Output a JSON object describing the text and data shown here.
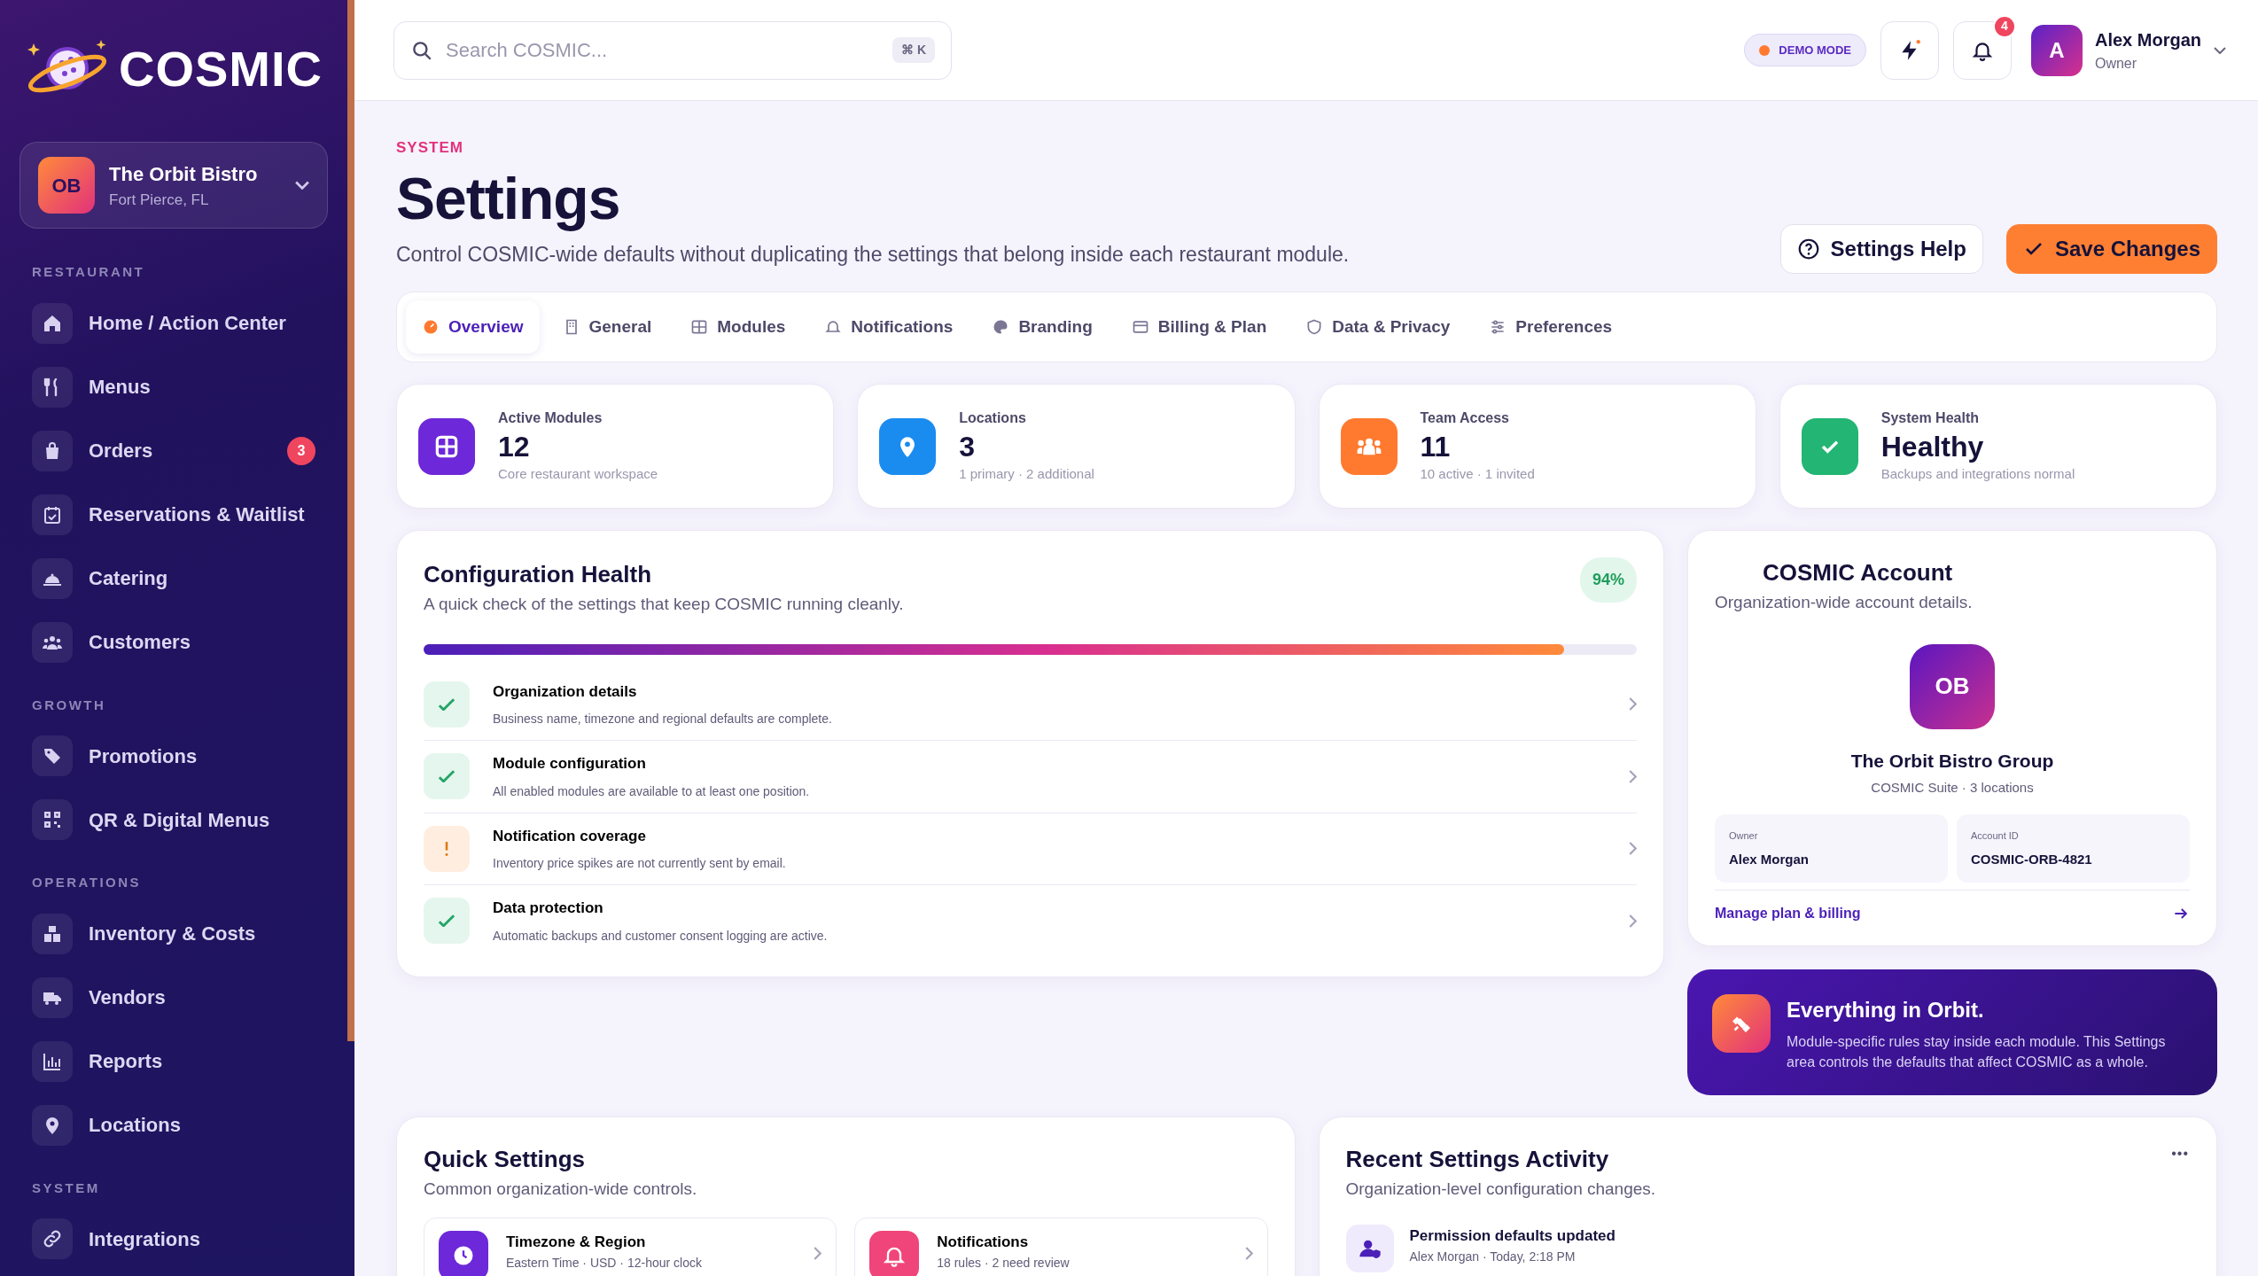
{
  "sidebar": {
    "brand": "COSMIC",
    "org": {
      "initials": "OB",
      "name": "The Orbit Bistro",
      "place": "Fort Pierce, FL"
    },
    "sections": [
      {
        "label": "RESTAURANT",
        "items": [
          {
            "label": "Home / Action Center"
          },
          {
            "label": "Menus"
          },
          {
            "label": "Orders",
            "badge": "3"
          },
          {
            "label": "Reservations & Waitlist"
          },
          {
            "label": "Catering"
          },
          {
            "label": "Customers"
          }
        ]
      },
      {
        "label": "GROWTH",
        "items": [
          {
            "label": "Promotions"
          },
          {
            "label": "QR & Digital Menus"
          }
        ]
      },
      {
        "label": "OPERATIONS",
        "items": [
          {
            "label": "Inventory & Costs"
          },
          {
            "label": "Vendors"
          },
          {
            "label": "Reports"
          },
          {
            "label": "Locations"
          }
        ]
      },
      {
        "label": "SYSTEM",
        "items": [
          {
            "label": "Integrations"
          }
        ]
      }
    ]
  },
  "topbar": {
    "search": {
      "placeholder": "Search COSMIC...",
      "shortcut": "⌘ K"
    },
    "demo": "DEMO MODE",
    "notifications": "4",
    "user": {
      "initial": "A",
      "name": "Alex Morgan",
      "role": "Owner"
    }
  },
  "header": {
    "eyebrow": "SYSTEM",
    "title": "Settings",
    "description": "Control COSMIC-wide defaults without duplicating the settings that belong inside each restaurant module.",
    "buttons": [
      {
        "label": "Settings Help",
        "kind": "secondary"
      },
      {
        "label": "Save Changes",
        "kind": "primary"
      }
    ]
  },
  "tabs": [
    {
      "label": "Overview",
      "selected": true
    },
    {
      "label": "General",
      "selected": false
    },
    {
      "label": "Modules",
      "selected": false
    },
    {
      "label": "Notifications",
      "selected": false
    },
    {
      "label": "Branding",
      "selected": false
    },
    {
      "label": "Billing & Plan",
      "selected": false
    },
    {
      "label": "Data & Privacy",
      "selected": false
    },
    {
      "label": "Preferences",
      "selected": false
    }
  ],
  "stats": [
    {
      "label": "Active Modules",
      "value": "12",
      "note": "Core restaurant workspace",
      "color": "#6d28d9"
    },
    {
      "label": "Locations",
      "value": "3",
      "note": "1 primary · 2 additional",
      "color": "#1a8cf0"
    },
    {
      "label": "Team Access",
      "value": "11",
      "note": "10 active · 1 invited",
      "color": "#ff7a2f"
    },
    {
      "label": "System Health",
      "value": "Healthy",
      "note": "Backups and integrations normal",
      "color": "#22b573"
    }
  ],
  "health": {
    "title": "Configuration Health",
    "subtitle": "A quick check of the settings that keep COSMIC running cleanly.",
    "score": "94%",
    "level": 0.94,
    "items": [
      {
        "title": "Organization details",
        "text": "Business name, timezone and regional defaults are complete.",
        "warning": false
      },
      {
        "title": "Module configuration",
        "text": "All enabled modules are available to at least one position.",
        "warning": false
      },
      {
        "title": "Notification coverage",
        "text": "Inventory price spikes are not currently sent by email.",
        "warning": true
      },
      {
        "title": "Data protection",
        "text": "Automatic backups and customer consent logging are active.",
        "warning": false
      }
    ]
  },
  "account": {
    "title": "COSMIC Account",
    "subtitle": "Organization-wide account details.",
    "initials": "OB",
    "name": "The Orbit Bistro Group",
    "plan": "COSMIC Suite · 3 locations",
    "fields": [
      {
        "label": "Owner",
        "value": "Alex Morgan"
      },
      {
        "label": "Account ID",
        "value": "COSMIC-ORB-4821"
      }
    ],
    "link": "Manage plan & billing"
  },
  "banner": {
    "title": "Everything in Orbit.",
    "text": "Module-specific rules stay inside each module. This Settings area controls the defaults that affect COSMIC as a whole."
  },
  "quick": {
    "title": "Quick Settings",
    "subtitle": "Common organization-wide controls.",
    "items": [
      {
        "title": "Timezone & Region",
        "text": "Eastern Time · USD · 12-hour clock",
        "color": "#6d28d9"
      },
      {
        "title": "Notifications",
        "text": "18 rules · 2 need review",
        "color": "#f0457a"
      }
    ]
  },
  "activity": {
    "title": "Recent Settings Activity",
    "subtitle": "Organization-level configuration changes.",
    "menu": "•••",
    "items": [
      {
        "title": "Permission defaults updated",
        "text": "Alex Morgan · Today, 2:18 PM"
      }
    ]
  }
}
